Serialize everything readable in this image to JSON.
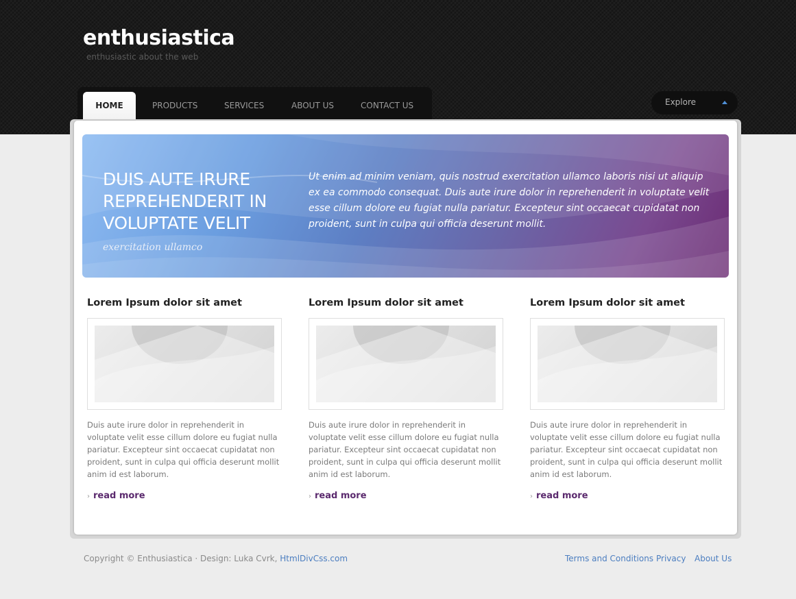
{
  "site": {
    "logo": "enthusiastica",
    "tagline": "enthusiastic about the web"
  },
  "nav": {
    "items": [
      {
        "label": "HOME",
        "active": true
      },
      {
        "label": "PRODUCTS",
        "active": false
      },
      {
        "label": "SERVICES",
        "active": false
      },
      {
        "label": "ABOUT US",
        "active": false
      },
      {
        "label": "CONTACT US",
        "active": false
      }
    ]
  },
  "explore": {
    "label": "Explore",
    "icon": "caret-up-icon",
    "accent": "#4f8fd6"
  },
  "hero": {
    "title": "DUIS AUTE IRURE REPREHENDERIT IN VOLUPTATE VELIT",
    "subtitle": "exercitation ullamco",
    "text": "Ut enim ad minim veniam, quis nostrud exercitation ullamco laboris nisi ut aliquip ex ea commodo consequat. Duis aute irure dolor in reprehenderit in voluptate velit esse cillum dolore eu fugiat nulla pariatur. Excepteur sint occaecat cupidatat non proident, sunt in culpa qui officia deserunt mollit."
  },
  "columns": [
    {
      "title": "Lorem Ipsum dolor sit amet",
      "text": "Duis aute irure dolor in reprehenderit in voluptate velit esse cillum dolore eu fugiat nulla pariatur. Excepteur sint occaecat cupidatat non proident, sunt in culpa qui officia deserunt mollit anim id est laborum.",
      "link": "read more"
    },
    {
      "title": "Lorem Ipsum dolor sit amet",
      "text": "Duis aute irure dolor in reprehenderit in voluptate velit esse cillum dolore eu fugiat nulla pariatur. Excepteur sint occaecat cupidatat non proident, sunt in culpa qui officia deserunt mollit anim id est laborum.",
      "link": "read more"
    },
    {
      "title": "Lorem Ipsum dolor sit amet",
      "text": "Duis aute irure dolor in reprehenderit in voluptate velit esse cillum dolore eu fugiat nulla pariatur. Excepteur sint occaecat cupidatat non proident, sunt in culpa qui officia deserunt mollit anim id est laborum.",
      "link": "read more"
    }
  ],
  "footer": {
    "copyright": "Copyright © Enthusiastica · Design: Luka Cvrk,",
    "designer_link": "HtmlDivCss.com",
    "links": [
      "Terms and Conditions",
      "Privacy",
      "About Us"
    ]
  },
  "colors": {
    "header_bg": "#1b1b1b",
    "page_bg": "#ededed",
    "link": "#4c7ec0",
    "read_more": "#5b2a6e"
  }
}
